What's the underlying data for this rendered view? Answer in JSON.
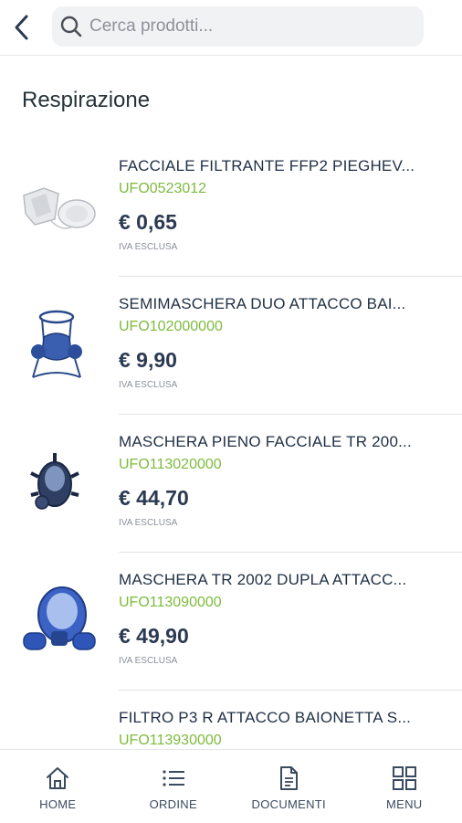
{
  "header": {
    "back_icon": "chevron-left-icon",
    "search": {
      "placeholder": "Cerca prodotti...",
      "icon": "search-icon"
    }
  },
  "section": {
    "title": "Respirazione"
  },
  "products": [
    {
      "name": "FACCIALE FILTRANTE FFP2 PIEGHEV...",
      "code": "UFO0523012",
      "price": "€ 0,65",
      "vat": "IVA ESCLUSA"
    },
    {
      "name": "SEMIMASCHERA DUO ATTACCO BAI...",
      "code": "UFO102000000",
      "price": "€ 9,90",
      "vat": "IVA ESCLUSA"
    },
    {
      "name": "MASCHERA PIENO FACCIALE TR 200...",
      "code": "UFO113020000",
      "price": "€ 44,70",
      "vat": "IVA ESCLUSA"
    },
    {
      "name": "MASCHERA TR 2002 DUPLA ATTACC...",
      "code": "UFO113090000",
      "price": "€ 49,90",
      "vat": "IVA ESCLUSA"
    },
    {
      "name": "FILTRO P3 R ATTACCO BAIONETTA S...",
      "code": "UFO113930000",
      "price": "",
      "vat": ""
    }
  ],
  "nav": {
    "home": "HOME",
    "ordine": "ORDINE",
    "documenti": "DOCUMENTI",
    "menu": "MENU"
  },
  "colors": {
    "code_green": "#7dbb3c",
    "text_dark": "#1f2f45",
    "accent_blue": "#2f4fa0"
  }
}
